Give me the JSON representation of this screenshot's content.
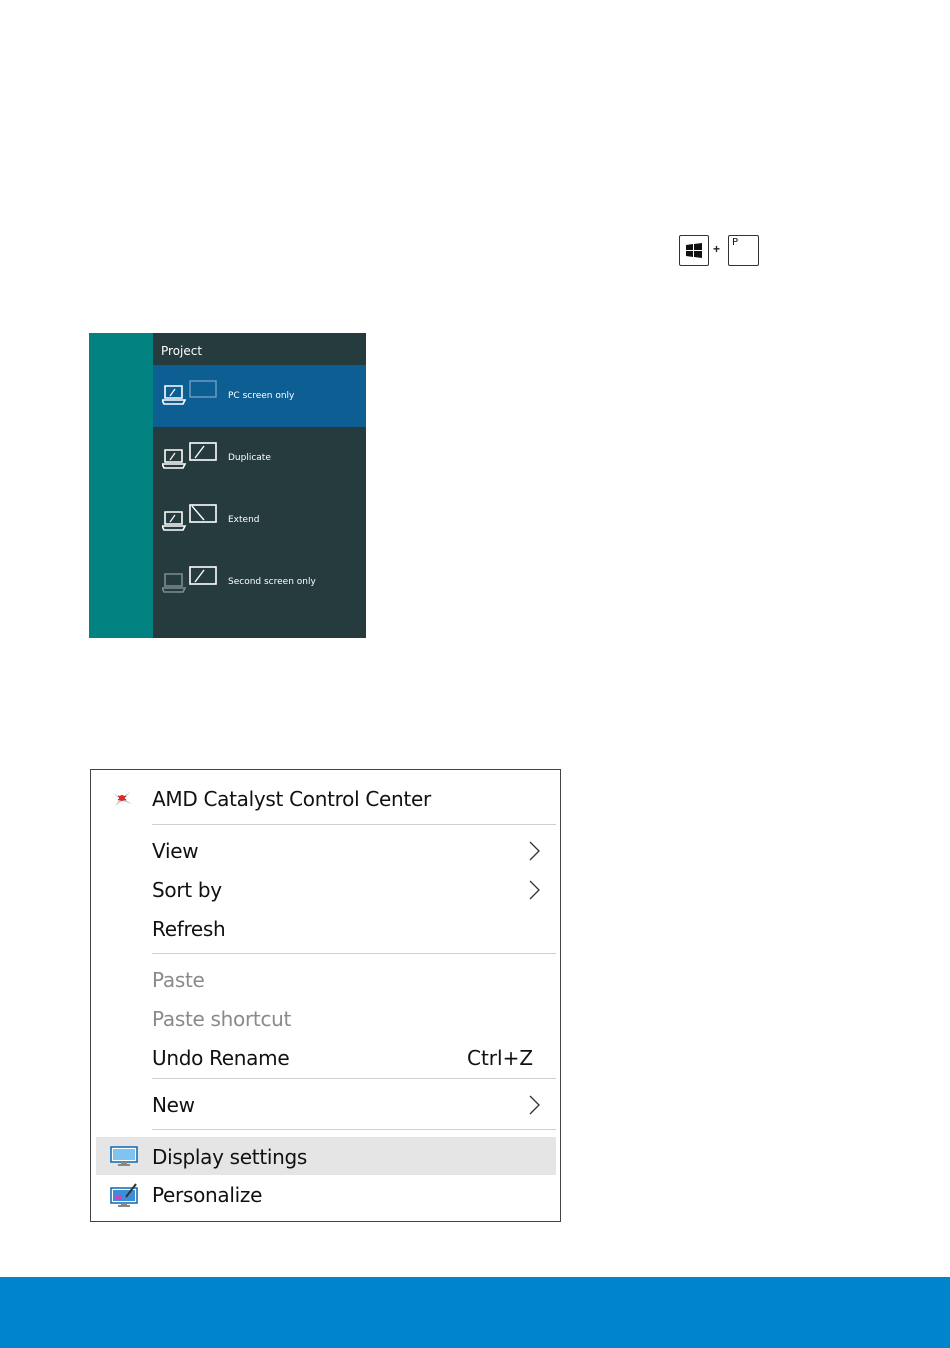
{
  "shortcut": {
    "win_icon": "windows-logo-icon",
    "plus": "+",
    "key": "P"
  },
  "project_panel": {
    "title": "Project",
    "items": [
      {
        "label": "PC screen only",
        "icon": "pc-screen-only-icon",
        "selected": true
      },
      {
        "label": "Duplicate",
        "icon": "duplicate-icon",
        "selected": false
      },
      {
        "label": "Extend",
        "icon": "extend-icon",
        "selected": false
      },
      {
        "label": "Second screen only",
        "icon": "second-screen-only-icon",
        "selected": false
      }
    ],
    "colors": {
      "panel": "#263b3d",
      "sidebar": "#028381",
      "selected": "#0d5e93"
    }
  },
  "context_menu": {
    "items": [
      {
        "label": "AMD Catalyst Control Center",
        "icon": "amd-catalyst-icon"
      },
      {
        "label": "View",
        "submenu": true
      },
      {
        "label": "Sort by",
        "submenu": true
      },
      {
        "label": "Refresh"
      },
      {
        "label": "Paste",
        "disabled": true
      },
      {
        "label": "Paste shortcut",
        "disabled": true
      },
      {
        "label": "Undo Rename",
        "shortcut": "Ctrl+Z"
      },
      {
        "label": "New",
        "submenu": true
      },
      {
        "label": "Display settings",
        "icon": "display-settings-icon",
        "highlighted": true
      },
      {
        "label": "Personalize",
        "icon": "personalize-icon"
      }
    ]
  },
  "footer": {
    "color": "#0085cc"
  }
}
